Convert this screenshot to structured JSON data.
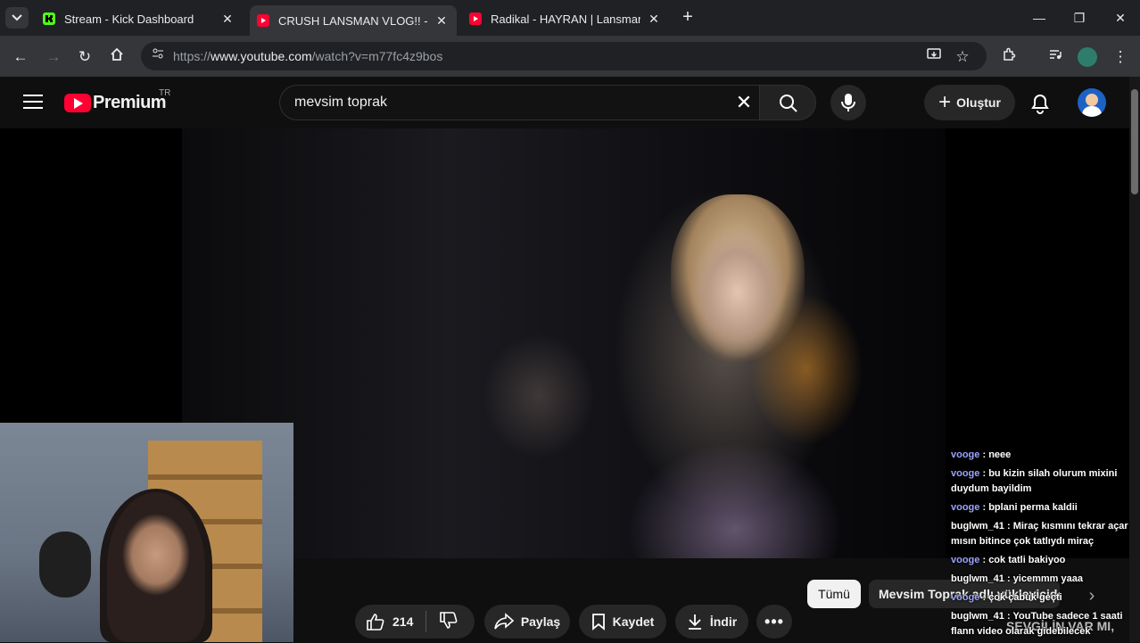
{
  "browser": {
    "tabs": [
      {
        "title": "Stream - Kick Dashboard",
        "favicon": "kick-icon",
        "active": false
      },
      {
        "title": "CRUSH LANSMAN VLOG!! - YouTube",
        "favicon": "youtube-icon",
        "active": true
      },
      {
        "title": "Radikal - HAYRAN | Lansman Vlog",
        "favicon": "youtube-icon",
        "active": false
      }
    ],
    "url_prefix": "https://",
    "url_host": "www.youtube.com",
    "url_path": "/watch?v=m77fc4z9bos"
  },
  "youtube": {
    "logo_text": "Premium",
    "country_code": "TR",
    "search_query": "mevsim toprak",
    "create_label": "Oluştur",
    "actions": {
      "like_count": "214",
      "share_label": "Paylaş",
      "save_label": "Kaydet",
      "download_label": "İndir"
    },
    "chips": {
      "all_label": "Tümü",
      "uploader_label": "Mevsim Toprak adlı yükleyiciden"
    },
    "overlay_text": "SEVGİLİN VAR MI,"
  },
  "chat": [
    {
      "user": "vooge",
      "text": ": neee"
    },
    {
      "user": "vooge",
      "text": ": bu kizin silah olurum mixini duydum bayildim"
    },
    {
      "user": "vooge",
      "text": ": bplani perma kaldii"
    },
    {
      "user": "buglwm_41",
      "text": ": Miraç kısmını tekrar açar mısın bitince çok tatlıydı miraç"
    },
    {
      "user": "vooge",
      "text": ": cok tatli bakiyoo"
    },
    {
      "user": "buglwm_41",
      "text": ": yicemmm yaaa"
    },
    {
      "user": "vooge",
      "text": ": çok çabuk geçti"
    },
    {
      "user": "buglwm_41",
      "text": ": YouTube sadece 1 saati flann video olarak gidebilecek"
    }
  ],
  "colors": {
    "youtube_red": "#ff0033",
    "kick_green": "#53fc18",
    "chat_user_purple": "#9aa3ff"
  }
}
